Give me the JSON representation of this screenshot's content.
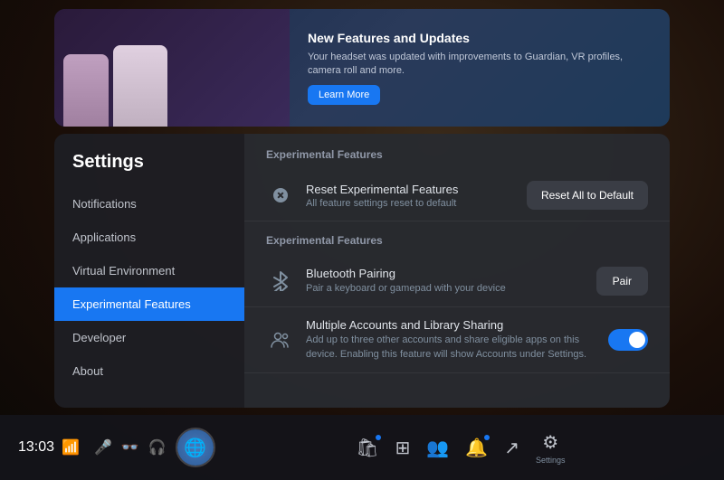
{
  "app": {
    "title": "Settings"
  },
  "banner": {
    "title": "New Features and Updates",
    "description": "Your headset was updated with improvements to Guardian, VR profiles, camera roll and more.",
    "learn_more": "Learn More"
  },
  "sidebar": {
    "title": "Settings",
    "items": [
      {
        "id": "notifications",
        "label": "Notifications",
        "active": false
      },
      {
        "id": "applications",
        "label": "Applications",
        "active": false
      },
      {
        "id": "virtual-environment",
        "label": "Virtual Environment",
        "active": false
      },
      {
        "id": "experimental-features",
        "label": "Experimental Features",
        "active": true
      },
      {
        "id": "developer",
        "label": "Developer",
        "active": false
      },
      {
        "id": "about",
        "label": "About",
        "active": false
      }
    ]
  },
  "content": {
    "section1": "Experimental Features",
    "reset_row": {
      "title": "Reset Experimental Features",
      "subtitle": "All feature settings reset to default",
      "button": "Reset All to Default"
    },
    "section2": "Experimental Features",
    "features": [
      {
        "id": "bluetooth-pairing",
        "title": "Bluetooth Pairing",
        "subtitle": "Pair a keyboard or gamepad with your device",
        "action": "button",
        "button_label": "Pair"
      },
      {
        "id": "multiple-accounts",
        "title": "Multiple Accounts and Library Sharing",
        "subtitle": "Add up to three other accounts and share eligible apps on this device. Enabling this feature will show Accounts under Settings.",
        "action": "toggle",
        "toggle_on": true
      }
    ]
  },
  "taskbar": {
    "time": "13:03",
    "icons": [
      {
        "id": "mic",
        "symbol": "🎤",
        "label": ""
      },
      {
        "id": "vr-glasses",
        "symbol": "🥽",
        "label": ""
      },
      {
        "id": "headphones",
        "symbol": "🎧",
        "label": ""
      }
    ],
    "center_icons": [
      {
        "id": "store",
        "symbol": "🛍",
        "label": "",
        "dot": true
      },
      {
        "id": "grid",
        "symbol": "⊞",
        "label": ""
      },
      {
        "id": "people",
        "symbol": "👥",
        "label": ""
      },
      {
        "id": "bell",
        "symbol": "🔔",
        "label": "",
        "dot": true
      },
      {
        "id": "share",
        "symbol": "↗",
        "label": ""
      },
      {
        "id": "settings",
        "symbol": "⚙",
        "label": "Settings"
      }
    ]
  }
}
